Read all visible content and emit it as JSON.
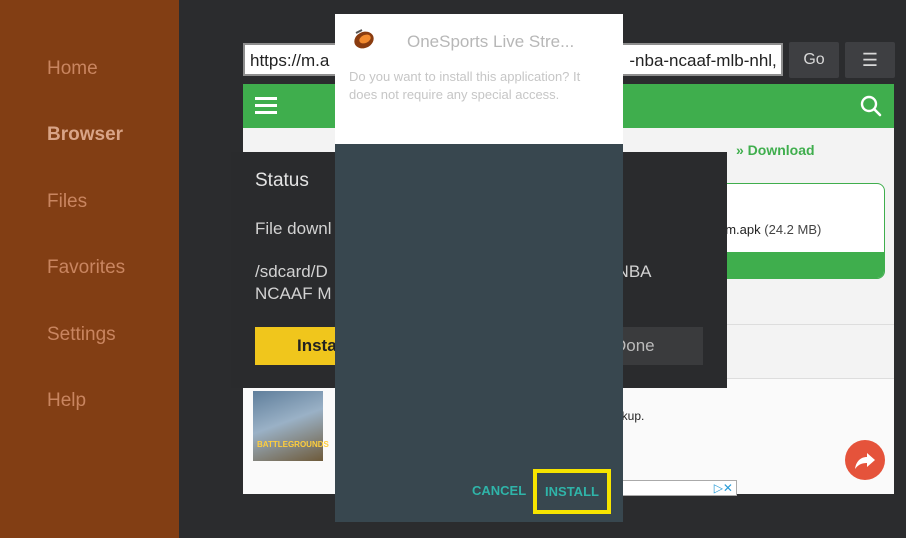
{
  "sidebar": {
    "items": [
      {
        "label": "Home"
      },
      {
        "label": "Browser"
      },
      {
        "label": "Files"
      },
      {
        "label": "Favorites"
      },
      {
        "label": "Settings"
      },
      {
        "label": "Help"
      }
    ],
    "active": "Browser",
    "background": "#823e14"
  },
  "browser": {
    "url_display": "https://m.a",
    "url_tail": "-nba-ncaaf-mlb-nhl,",
    "go_label": "Go",
    "menu_icon": "hamburger-icon"
  },
  "webpage": {
    "header_color": "#3fae4d",
    "breadcrumb_link": "» Download",
    "download_file": "om.apk",
    "download_size": "(24.2 MB)",
    "ad_text": "ickup."
  },
  "status_dialog": {
    "title": "Status",
    "message": "File downl",
    "path_line1": "/sdcard/D",
    "path_line1_tail": "L NBA",
    "path_line2": "NCAAF M",
    "install_label": "Insta",
    "done_label": "Done",
    "install_color": "#f0c61c"
  },
  "install_modal": {
    "app_name": "OneSports Live Stre...",
    "description": "Do you want to install this application? It does not require any special access.",
    "cancel_label": "CANCEL",
    "install_label": "INSTALL",
    "accent_color": "#2fb4a9",
    "highlight_color": "#f6e400"
  }
}
